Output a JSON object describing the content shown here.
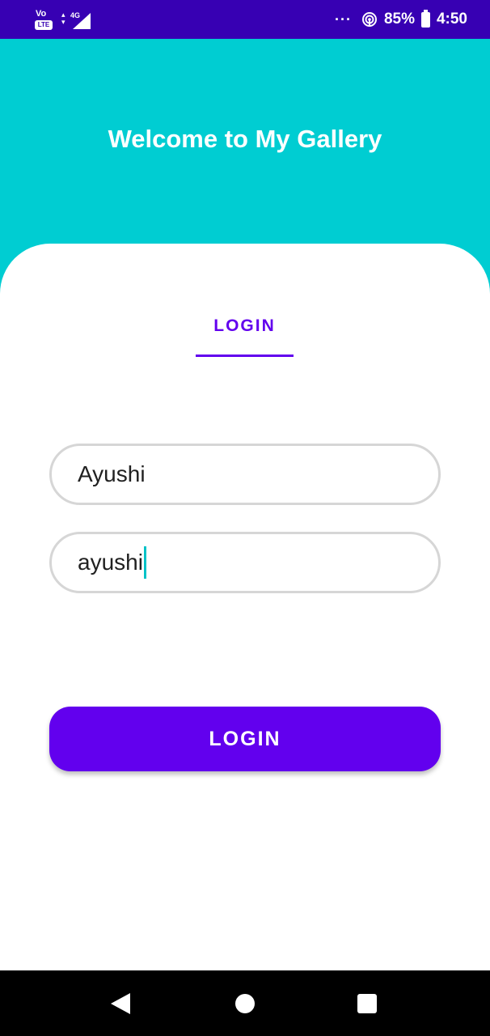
{
  "status_bar": {
    "volte_top": "Vo",
    "volte_bottom": "LTE",
    "network_type": "4G",
    "more_indicator": "···",
    "hotspot_icon": "hotspot-icon",
    "battery_percent": "85%",
    "battery_icon": "battery-icon",
    "time": "4:50"
  },
  "header": {
    "title": "Welcome to My Gallery"
  },
  "tabs": [
    {
      "label": "LOGIN",
      "selected": true
    }
  ],
  "form": {
    "username_value": "Ayushi",
    "password_value": "ayushi",
    "submit_label": "LOGIN"
  },
  "nav_bar": {
    "back_icon": "back-triangle-icon",
    "home_icon": "home-circle-icon",
    "recents_icon": "recents-square-icon"
  },
  "colors": {
    "status_bar": "#3700b3",
    "header_bg": "#00cdd2",
    "accent": "#6200ee",
    "field_border": "#d6d6d6",
    "caret": "#00c2c7",
    "nav_bar": "#000000"
  }
}
